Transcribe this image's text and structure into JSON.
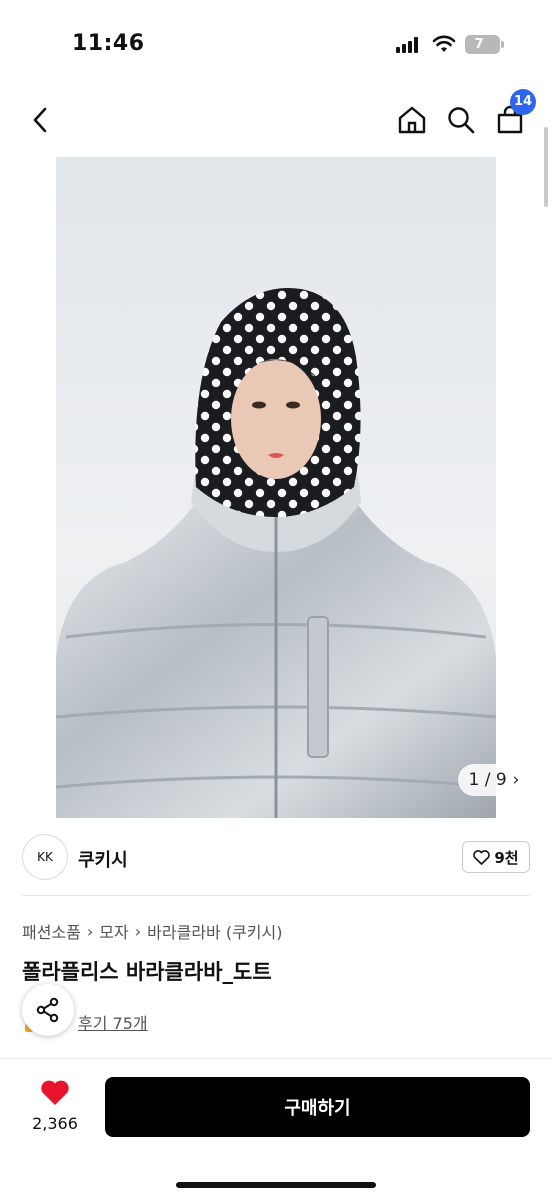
{
  "status_bar": {
    "time": "11:46",
    "battery": "7"
  },
  "header": {
    "cart_badge": "14"
  },
  "image_counter": {
    "text": "1 / 9",
    "arrow": "›"
  },
  "seller": {
    "avatar_text": "KK",
    "name": "쿠키시",
    "likes": "9천"
  },
  "breadcrumb": [
    "패션소품",
    "모자",
    "바라클라바 (쿠키시)"
  ],
  "product": {
    "title": "폴라플리스 바라클라바_도트",
    "reviews": "후기 75개"
  },
  "bottom": {
    "like_count": "2,366",
    "buy_label": "구매하기"
  },
  "colors": {
    "accent_badge": "#2d64f0",
    "heart": "#e8132c",
    "buy_button": "#000000"
  }
}
